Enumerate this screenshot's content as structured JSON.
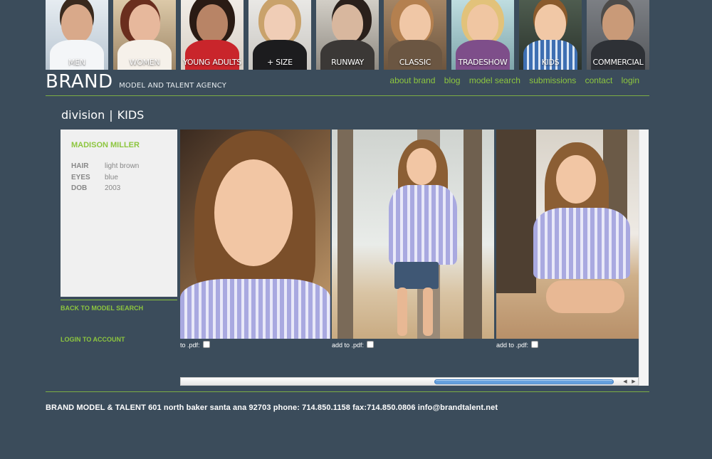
{
  "categories": [
    {
      "label": "MEN",
      "bg": "#cdd6df",
      "face": "#d9a98a",
      "body": "#f4f6f8",
      "hair": "#3a2a1e"
    },
    {
      "label": "WOMEN",
      "bg": "#c9b79f",
      "face": "#e7b89c",
      "body": "#f6f1ea",
      "hair": "#6a2e1e"
    },
    {
      "label": "YOUNG ADULTS",
      "bg": "#e8e2da",
      "face": "#b88466",
      "body": "#c9252b",
      "hair": "#2a1b14"
    },
    {
      "label": "+ SIZE",
      "bg": "#d9d7d3",
      "face": "#f0cdb6",
      "body": "#1c1c1e",
      "hair": "#c9a26b"
    },
    {
      "label": "RUNWAY",
      "bg": "#b9b5ad",
      "face": "#d8b79e",
      "body": "#3b3836",
      "hair": "#2a201b"
    },
    {
      "label": "CLASSIC",
      "bg": "#8b6f52",
      "face": "#f0c7a6",
      "body": "#6b5642",
      "hair": "#b4804f"
    },
    {
      "label": "TRADESHOW",
      "bg": "#9ec2c8",
      "face": "#f0c6a2",
      "body": "#7e4e8a",
      "hair": "#e2c27a"
    },
    {
      "label": "KIDS",
      "bg": "#3d4a3f",
      "face": "#f1c8a6",
      "body": "#3e6fb2",
      "hair": "#8a5a2c"
    },
    {
      "label": "COMMERCIAL",
      "bg": "#6c6f73",
      "face": "#c99a78",
      "body": "#2e3136",
      "hair": "#4d4b49"
    }
  ],
  "header": {
    "logo_big": "BRAND",
    "logo_small": "MODEL AND TALENT AGENCY",
    "nav": [
      "about brand",
      "blog",
      "model search",
      "submissions",
      "contact",
      "login"
    ]
  },
  "division": {
    "label": "division",
    "separator": "|",
    "name": "KIDS"
  },
  "model": {
    "name": "MADISON MILLER",
    "attributes": [
      {
        "key": "HAIR",
        "value": "light brown"
      },
      {
        "key": "EYES",
        "value": "blue"
      },
      {
        "key": "DOB",
        "value": "2003"
      }
    ]
  },
  "side_links": {
    "back": "BACK TO MODEL SEARCH",
    "login": "LOGIN TO ACCOUNT"
  },
  "photos": [
    {
      "pdf_label": "to .pdf:"
    },
    {
      "pdf_label": "add to .pdf:"
    },
    {
      "pdf_label": "add to .pdf:"
    }
  ],
  "footer": {
    "text": "BRAND MODEL & TALENT 601 north baker santa ana 92703 phone: 714.850.1158 fax:714.850.0806 info@brandtalent.net"
  },
  "colors": {
    "accent": "#8dc63f",
    "background": "#3b4c5b",
    "panel": "#f0f0f0"
  }
}
